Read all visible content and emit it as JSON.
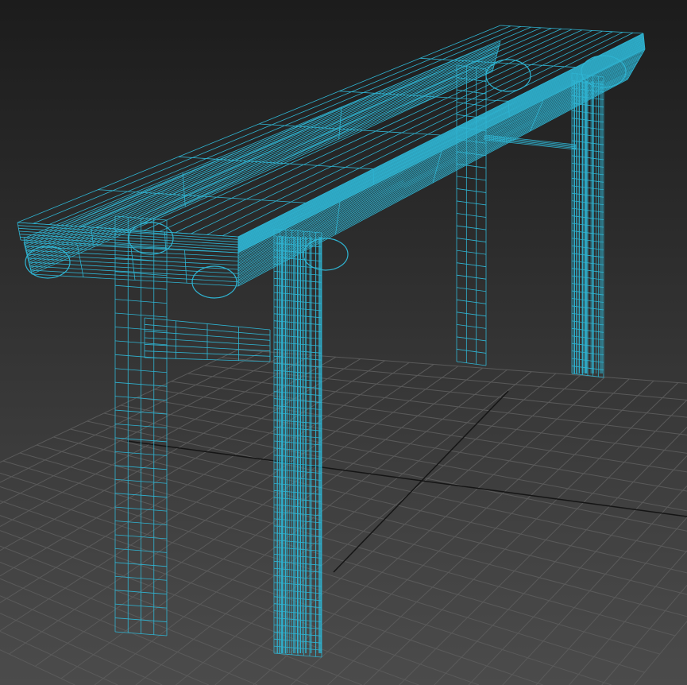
{
  "viewport": {
    "view": "perspective",
    "shading": "wireframe",
    "object": "console-table",
    "colors": {
      "wire": "#2fb4d2",
      "grid": "#5a5a5a",
      "grid_axis": "#151515",
      "background_top": "#1c1c1c",
      "background_bottom": "#4b4b4b"
    }
  }
}
